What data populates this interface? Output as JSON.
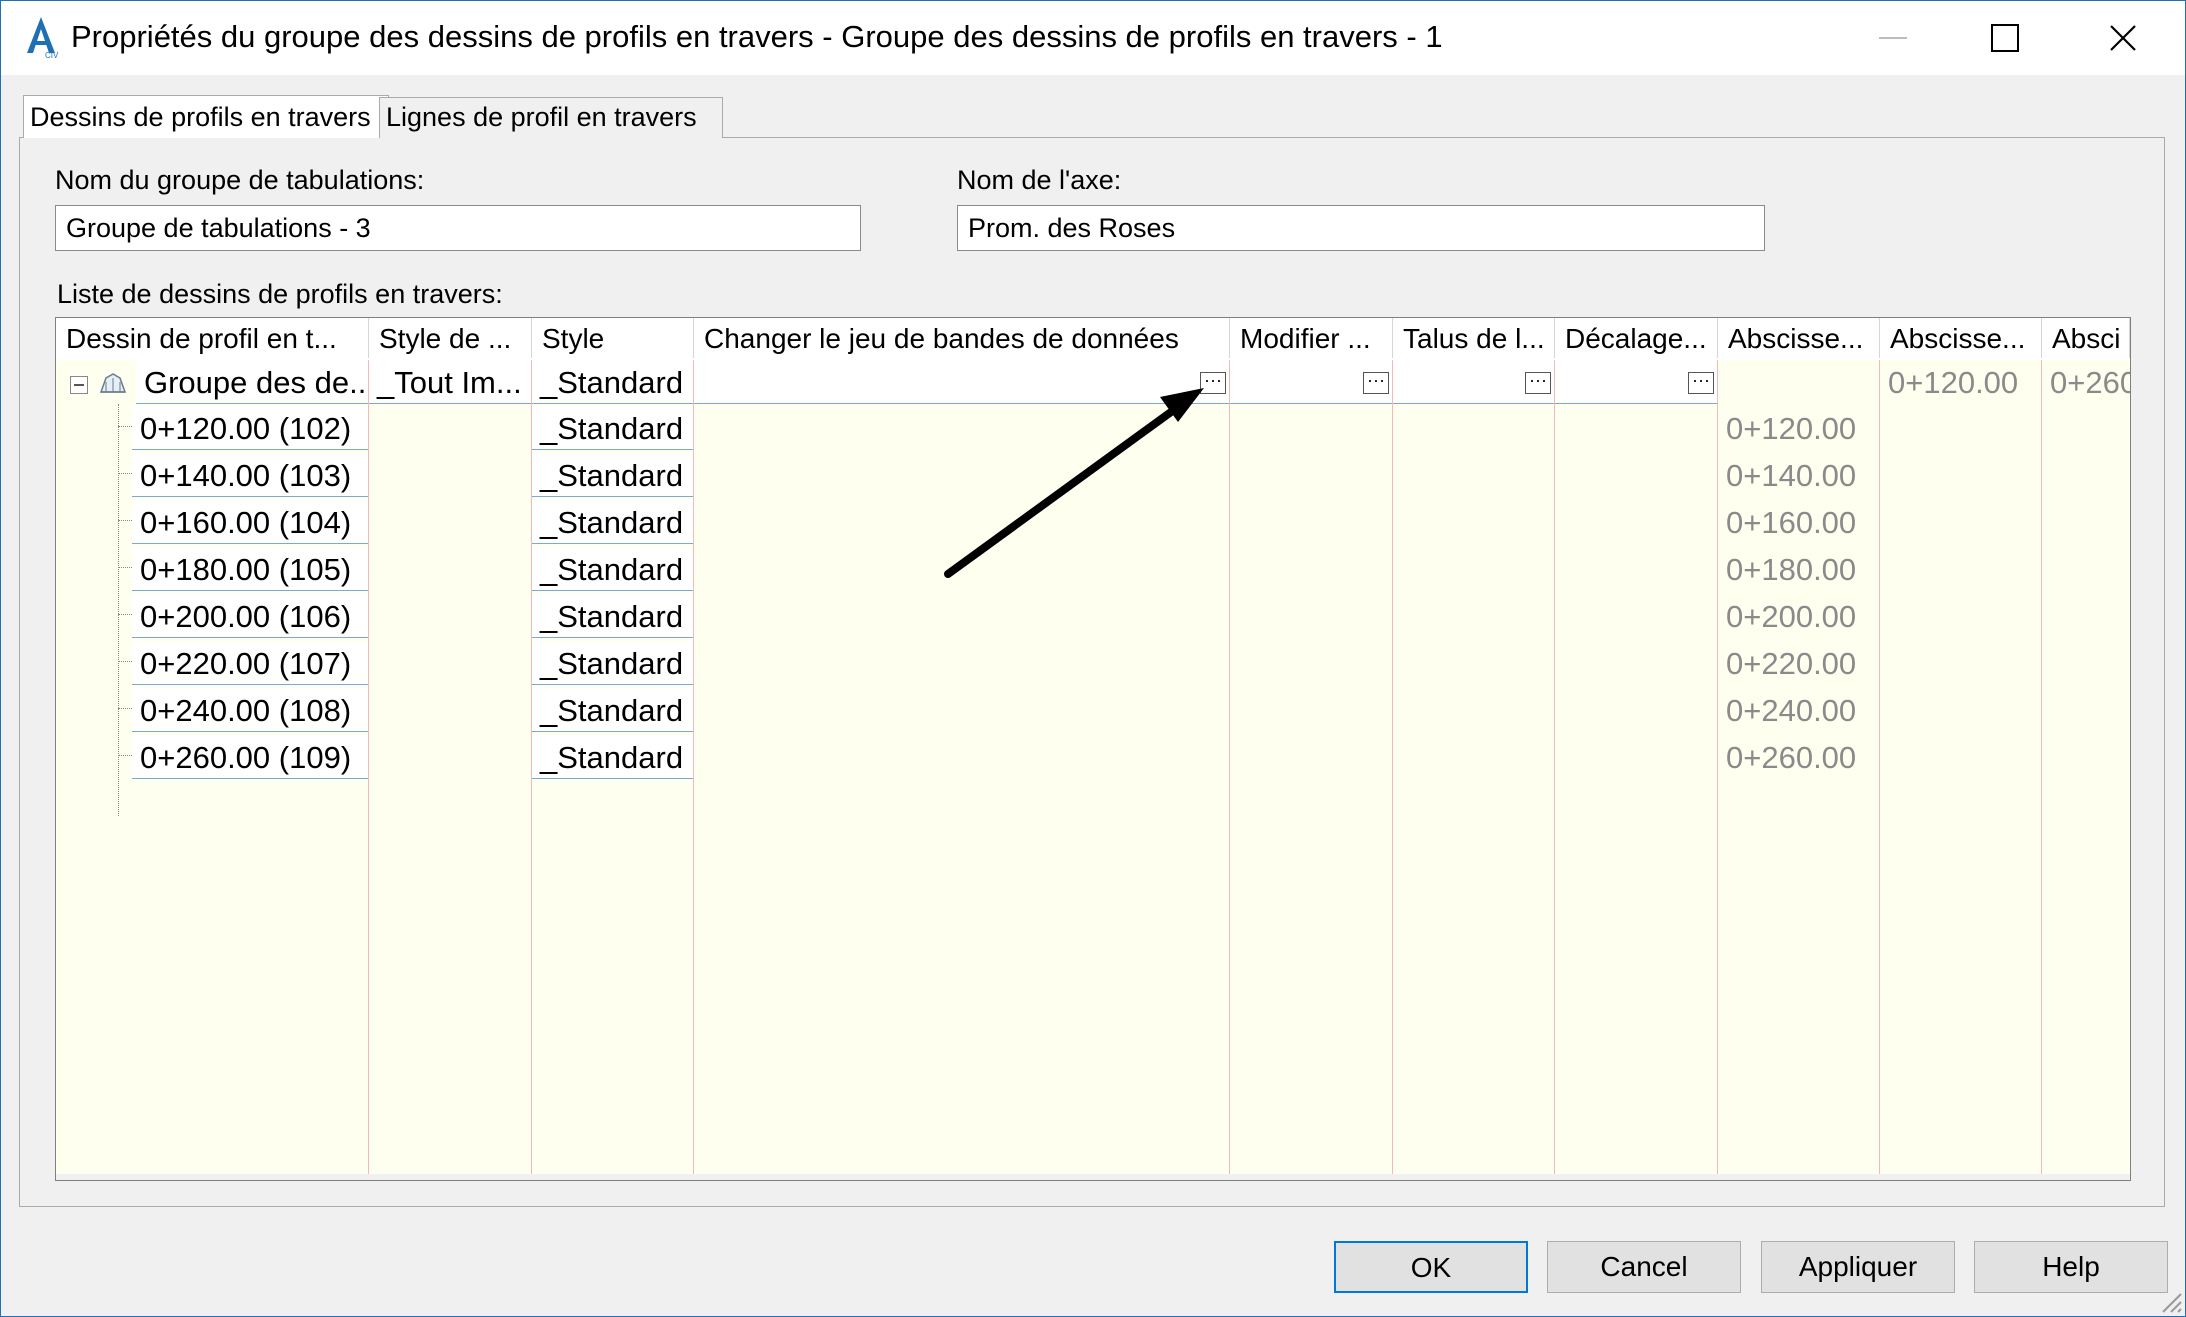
{
  "window": {
    "title": "Propriétés du groupe des dessins de profils en travers - Groupe des dessins de profils en travers - 1",
    "icon": "civil3d-app-icon"
  },
  "tabs": [
    {
      "label": "Dessins de profils en travers",
      "active": true
    },
    {
      "label": "Lignes de profil en travers",
      "active": false
    }
  ],
  "form": {
    "group_name_label": "Nom du groupe de tabulations:",
    "group_name_value": "Groupe de tabulations - 3",
    "axis_label": "Nom de l'axe:",
    "axis_value": "Prom. des Roses",
    "list_label": "Liste de dessins de profils en travers:"
  },
  "grid": {
    "columns": [
      "Dessin de profil en t...",
      "Style de ...",
      "Style",
      "Changer le jeu de bandes de données",
      "Modifier ...",
      "Talus de l...",
      "Décalage...",
      "Abscisse...",
      "Abscisse...",
      "Absci"
    ],
    "group_row": {
      "name": "Groupe des de...",
      "style_de": "_Tout Im...",
      "style": "_Standard",
      "abscisse2": "0+120.00",
      "abscisse3": "0+260"
    },
    "rows": [
      {
        "name": "0+120.00 (102)",
        "style": "_Standard",
        "abscisse": "0+120.00"
      },
      {
        "name": "0+140.00 (103)",
        "style": "_Standard",
        "abscisse": "0+140.00"
      },
      {
        "name": "0+160.00 (104)",
        "style": "_Standard",
        "abscisse": "0+160.00"
      },
      {
        "name": "0+180.00 (105)",
        "style": "_Standard",
        "abscisse": "0+180.00"
      },
      {
        "name": "0+200.00 (106)",
        "style": "_Standard",
        "abscisse": "0+200.00"
      },
      {
        "name": "0+220.00 (107)",
        "style": "_Standard",
        "abscisse": "0+220.00"
      },
      {
        "name": "0+240.00 (108)",
        "style": "_Standard",
        "abscisse": "0+240.00"
      },
      {
        "name": "0+260.00 (109)",
        "style": "_Standard",
        "abscisse": "0+260.00"
      }
    ],
    "ellipsis_glyph": "···"
  },
  "buttons": {
    "ok": "OK",
    "cancel": "Cancel",
    "apply": "Appliquer",
    "help": "Help"
  },
  "scroll": {
    "left_glyph": "‹",
    "right_glyph": "›"
  }
}
